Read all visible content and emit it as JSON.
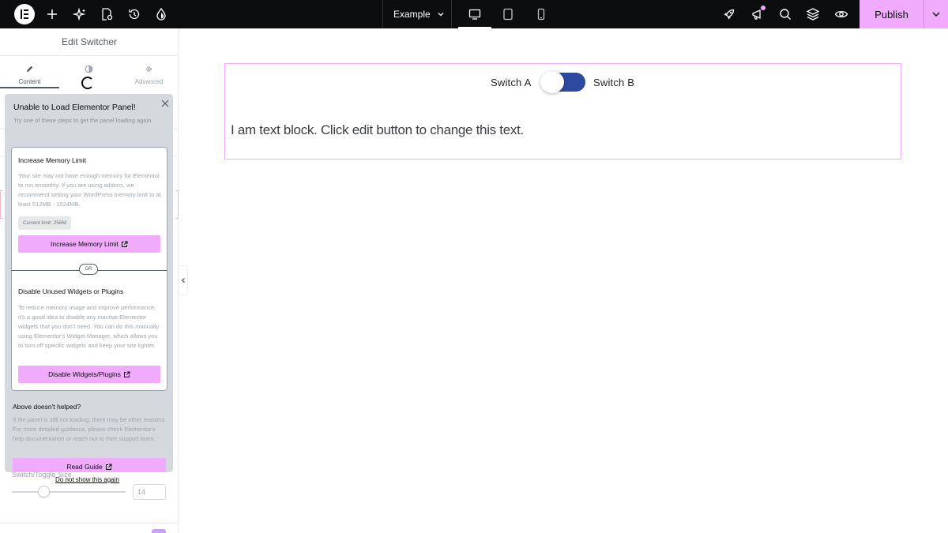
{
  "topbar": {
    "site_name": "Example",
    "publish_label": "Publish",
    "active_device": "desktop",
    "icons": [
      "elementor-logo-icon",
      "plus-icon",
      "sparkle-icon",
      "page-settings-icon",
      "history-icon",
      "theme-style-icon",
      "rocket-icon",
      "whats-new-icon",
      "search-icon",
      "structure-icon",
      "preview-eye-icon",
      "chevron-down-icon"
    ]
  },
  "panel": {
    "title": "Edit Switcher",
    "tabs": [
      {
        "label": "Content",
        "icon": "pencil-icon"
      },
      {
        "label": "",
        "icon": "style-half-circle-icon"
      },
      {
        "label": "Advanced",
        "icon": "gear-icon"
      }
    ],
    "active_tab": "Content",
    "control_label": "Switch/Toggle Size",
    "control_value": "14"
  },
  "modal": {
    "title": "Unable to Load Elementor Panel!",
    "subtitle": "Try one of these steps to get the panel loading again.",
    "memory": {
      "title": "Increase Memory Limit",
      "body": "Your site may not have enough memory for Elementor to run smoothly. If you are using addons, we recommend setting your WordPress memory limit to at least 512MB - 1024MB.",
      "current_limit": "Current limit: 256M",
      "button": "Increase Memory Limit"
    },
    "or_label": "OR",
    "widgets": {
      "title": "Disable Unused Widgets or Plugins",
      "body": "To reduce memory usage and improve performance, it's a good idea to disable any inactive Elementor widgets that you don't need. You can do this manually using Elementor's Widget Manager, which allows you to turn off specific widgets and keep your site lighter.",
      "button": "Disable Widgets/Plugins"
    },
    "footer": {
      "title": "Above doesn't helped?",
      "body": "If the panel is still not loading, there may be other reasons. For more detailed guidance, please check Elementor's help documentation or reach out to their support team.",
      "button": "Read Guide"
    },
    "dont_show": "Do not show this again"
  },
  "canvas": {
    "switch_a": "Switch A",
    "switch_b": "Switch B",
    "switch_state": "B",
    "text_block": "I am text block. Click edit button to change this text."
  },
  "colors": {
    "topbar_bg": "#0c0d0e",
    "accent_pink": "#f0abfc",
    "toggle_blue": "#2e4a9e"
  }
}
